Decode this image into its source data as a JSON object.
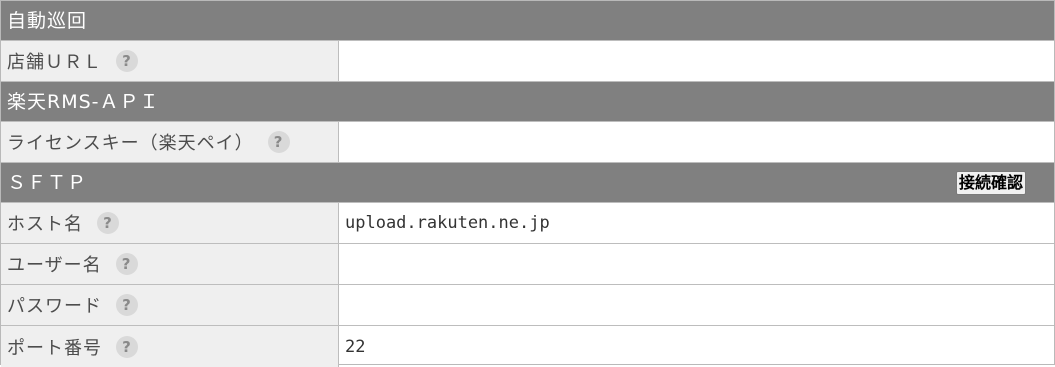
{
  "sections": {
    "auto_patrol": {
      "title": "自動巡回",
      "store_url": {
        "label": "店舗ＵＲＬ",
        "value": ""
      }
    },
    "rms_api": {
      "title": "楽天RMS-ＡＰＩ",
      "license_key": {
        "label": "ライセンスキー（楽天ペイ）",
        "value": ""
      }
    },
    "sftp": {
      "title": "ＳＦＴＰ",
      "connect_button": "接続確認",
      "host": {
        "label": "ホスト名",
        "value": "upload.rakuten.ne.jp"
      },
      "username": {
        "label": "ユーザー名",
        "value": ""
      },
      "password": {
        "label": "パスワード",
        "value": ""
      },
      "port": {
        "label": "ポート番号",
        "value": "22"
      }
    }
  },
  "help_glyph": "?",
  "colors": {
    "section_bg": "#808080",
    "label_bg": "#efefef",
    "border": "#bdbdbd",
    "help_bg": "#d9d9d9"
  }
}
